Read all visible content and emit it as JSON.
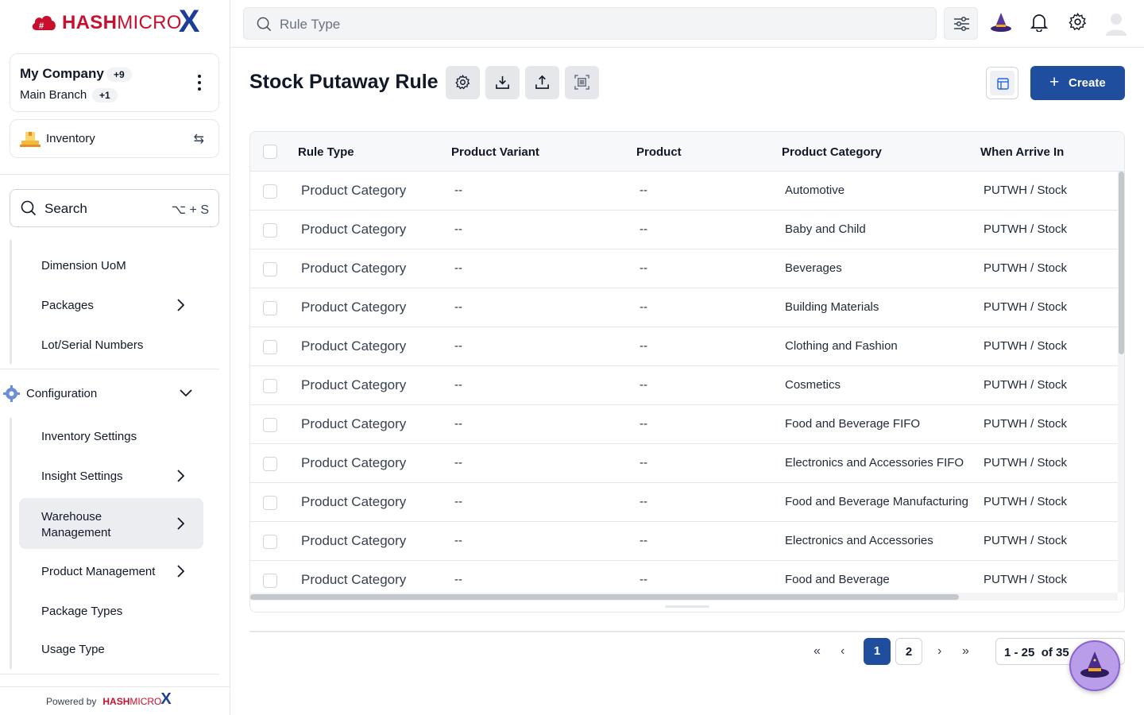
{
  "brand": {
    "name_bold": "HASH",
    "name_light": "MICRO",
    "mark": "X",
    "color": "#c8102e",
    "accent": "#1d3d9b"
  },
  "company": {
    "name": "My Company",
    "count_badge": "+9",
    "branch": "Main Branch",
    "branch_badge": "+1"
  },
  "module": {
    "label": "Inventory",
    "icon": "inventory-box-icon"
  },
  "sidebar_search": {
    "label": "Search",
    "shortcut": "⌥ + S"
  },
  "sidebar": {
    "group1": [
      "Dimension UoM",
      "Packages",
      "Lot/Serial Numbers"
    ],
    "config_label": "Configuration",
    "config_items": [
      "Inventory Settings",
      "Insight Settings",
      "Warehouse Management",
      "Product Management",
      "Package Types",
      "Usage Type"
    ]
  },
  "powered_by": "Powered by",
  "topbar": {
    "search_placeholder": "Rule Type"
  },
  "page": {
    "title": "Stock Putaway Rule",
    "create_label": "Create"
  },
  "table": {
    "columns": [
      "Rule Type",
      "Product Variant",
      "Product",
      "Product Category",
      "When Arrive In"
    ],
    "rows": [
      [
        "Product Category",
        "--",
        "--",
        "Automotive",
        "PUTWH / Stock"
      ],
      [
        "Product Category",
        "--",
        "--",
        "Baby and Child",
        "PUTWH / Stock"
      ],
      [
        "Product Category",
        "--",
        "--",
        "Beverages",
        "PUTWH / Stock"
      ],
      [
        "Product Category",
        "--",
        "--",
        "Building Materials",
        "PUTWH / Stock"
      ],
      [
        "Product Category",
        "--",
        "--",
        "Clothing and Fashion",
        "PUTWH / Stock"
      ],
      [
        "Product Category",
        "--",
        "--",
        "Cosmetics",
        "PUTWH / Stock"
      ],
      [
        "Product Category",
        "--",
        "--",
        "Food and Beverage FIFO",
        "PUTWH / Stock"
      ],
      [
        "Product Category",
        "--",
        "--",
        "Electronics and Accessories FIFO",
        "PUTWH / Stock"
      ],
      [
        "Product Category",
        "--",
        "--",
        "Food and Beverage Manufacturing",
        "PUTWH / Stock"
      ],
      [
        "Product Category",
        "--",
        "--",
        "Electronics and Accessories",
        "PUTWH / Stock"
      ],
      [
        "Product Category",
        "--",
        "--",
        "Food and Beverage",
        "PUTWH / Stock"
      ]
    ]
  },
  "pagination": {
    "pages": [
      "1",
      "2"
    ],
    "current": "1",
    "range": "1 - 25  of 35"
  },
  "colors": {
    "primary": "#1f4e9e"
  }
}
